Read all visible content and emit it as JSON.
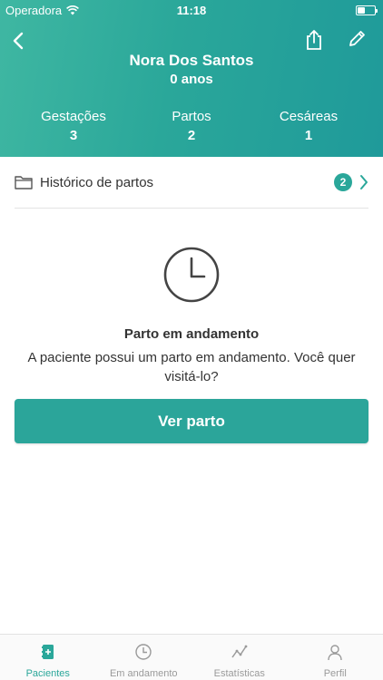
{
  "status_bar": {
    "carrier": "Operadora",
    "time": "11:18"
  },
  "patient": {
    "name": "Nora Dos Santos",
    "age": "0 anos"
  },
  "stats": [
    {
      "label": "Gestações",
      "value": "3"
    },
    {
      "label": "Partos",
      "value": "2"
    },
    {
      "label": "Cesáreas",
      "value": "1"
    }
  ],
  "history": {
    "label": "Histórico de partos",
    "count": "2"
  },
  "in_progress": {
    "title": "Parto em andamento",
    "description": "A paciente possui um parto em andamento. Você quer visitá-lo?",
    "button_label": "Ver parto"
  },
  "tabs": [
    {
      "label": "Pacientes",
      "icon": "patients-book-icon",
      "active": true
    },
    {
      "label": "Em andamento",
      "icon": "clock-icon",
      "active": false
    },
    {
      "label": "Estatísticas",
      "icon": "stats-line-icon",
      "active": false
    },
    {
      "label": "Perfil",
      "icon": "user-icon",
      "active": false
    }
  ],
  "colors": {
    "accent": "#2aa79a",
    "header_start": "#3fb7a2",
    "header_end": "#1f9a9a",
    "inactive_tab": "#9a9a9a"
  }
}
